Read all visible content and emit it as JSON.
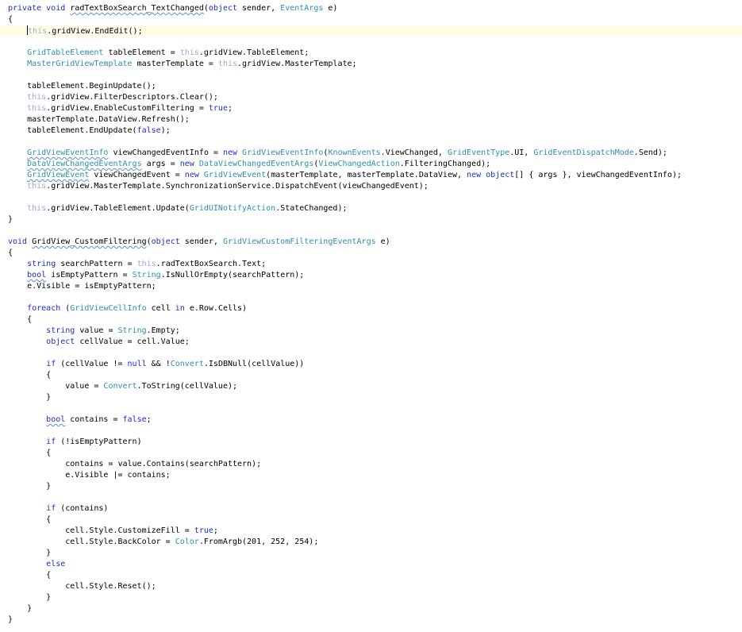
{
  "editor": {
    "caret_line": 2,
    "lines": [
      [
        [
          "private void ",
          "kw"
        ],
        [
          "radTextBoxSearch_TextChanged",
          "plain",
          "squiggle"
        ],
        [
          "(",
          "plain"
        ],
        [
          "object",
          "kw"
        ],
        [
          " sender, ",
          "plain"
        ],
        [
          "EventArgs",
          "type"
        ],
        [
          " e)",
          "plain"
        ]
      ],
      [
        [
          "{",
          "plain"
        ]
      ],
      [
        [
          "    ",
          "plain"
        ],
        [
          "this",
          "this"
        ],
        [
          ".gridView.EndEdit();",
          "plain"
        ]
      ],
      [],
      [
        [
          "    ",
          "plain"
        ],
        [
          "GridTableElement",
          "type"
        ],
        [
          " tableElement = ",
          "plain"
        ],
        [
          "this",
          "this"
        ],
        [
          ".gridView.TableElement;",
          "plain"
        ]
      ],
      [
        [
          "    ",
          "plain"
        ],
        [
          "MasterGridViewTemplate",
          "type"
        ],
        [
          " masterTemplate = ",
          "plain"
        ],
        [
          "this",
          "this"
        ],
        [
          ".gridView.MasterTemplate;",
          "plain"
        ]
      ],
      [],
      [
        [
          "    tableElement.BeginUpdate();",
          "plain"
        ]
      ],
      [
        [
          "    ",
          "plain"
        ],
        [
          "this",
          "this"
        ],
        [
          ".gridView.FilterDescriptors.Clear();",
          "plain"
        ]
      ],
      [
        [
          "    ",
          "plain"
        ],
        [
          "this",
          "this"
        ],
        [
          ".gridView.EnableCustomFiltering = ",
          "plain"
        ],
        [
          "true",
          "kw"
        ],
        [
          ";",
          "plain"
        ]
      ],
      [
        [
          "    masterTemplate.DataView.Refresh();",
          "plain"
        ]
      ],
      [
        [
          "    tableElement.EndUpdate(",
          "plain"
        ],
        [
          "false",
          "kw"
        ],
        [
          ");",
          "plain"
        ]
      ],
      [],
      [
        [
          "    ",
          "plain"
        ],
        [
          "GridViewEventInfo",
          "type",
          "squiggle"
        ],
        [
          " viewChangedEventInfo = ",
          "plain"
        ],
        [
          "new ",
          "kw"
        ],
        [
          "GridViewEventInfo",
          "type"
        ],
        [
          "(",
          "plain"
        ],
        [
          "KnownEvents",
          "type"
        ],
        [
          ".ViewChanged, ",
          "plain"
        ],
        [
          "GridEventType",
          "type"
        ],
        [
          ".UI, ",
          "plain"
        ],
        [
          "GridEventDispatchMode",
          "type"
        ],
        [
          ".Send);",
          "plain"
        ]
      ],
      [
        [
          "    ",
          "plain"
        ],
        [
          "DataViewChangedEventArgs",
          "type",
          "squiggle"
        ],
        [
          " args = ",
          "plain"
        ],
        [
          "new ",
          "kw"
        ],
        [
          "DataViewChangedEventArgs",
          "type"
        ],
        [
          "(",
          "plain"
        ],
        [
          "ViewChangedAction",
          "type"
        ],
        [
          ".FilteringChanged);",
          "plain"
        ]
      ],
      [
        [
          "    ",
          "plain"
        ],
        [
          "GridViewEvent",
          "type",
          "squiggle"
        ],
        [
          " viewChangedEvent = ",
          "plain"
        ],
        [
          "new ",
          "kw"
        ],
        [
          "GridViewEvent",
          "type"
        ],
        [
          "(masterTemplate, masterTemplate.DataView, ",
          "plain"
        ],
        [
          "new ",
          "kw"
        ],
        [
          "object",
          "kw"
        ],
        [
          "[] { args }, viewChangedEventInfo);",
          "plain"
        ]
      ],
      [
        [
          "    ",
          "plain"
        ],
        [
          "this",
          "this"
        ],
        [
          ".gridView.MasterTemplate.SynchronizationService.DispatchEvent(viewChangedEvent);",
          "plain"
        ]
      ],
      [],
      [
        [
          "    ",
          "plain"
        ],
        [
          "this",
          "this"
        ],
        [
          ".gridView.TableElement.Update(",
          "plain"
        ],
        [
          "GridUINotifyAction",
          "type"
        ],
        [
          ".StateChanged);",
          "plain"
        ]
      ],
      [
        [
          "}",
          "plain"
        ]
      ],
      [],
      [
        [
          "void ",
          "kw"
        ],
        [
          "GridView_CustomFiltering",
          "plain",
          "squiggle"
        ],
        [
          "(",
          "plain"
        ],
        [
          "object",
          "kw"
        ],
        [
          " sender, ",
          "plain"
        ],
        [
          "GridViewCustomFilteringEventArgs",
          "type"
        ],
        [
          " e)",
          "plain"
        ]
      ],
      [
        [
          "{",
          "plain"
        ]
      ],
      [
        [
          "    ",
          "plain"
        ],
        [
          "string",
          "kw"
        ],
        [
          " searchPattern = ",
          "plain"
        ],
        [
          "this",
          "this"
        ],
        [
          ".radTextBoxSearch.Text;",
          "plain"
        ]
      ],
      [
        [
          "    ",
          "plain"
        ],
        [
          "bool",
          "kw",
          "squiggle"
        ],
        [
          " isEmptyPattern = ",
          "plain"
        ],
        [
          "String",
          "type"
        ],
        [
          ".IsNullOrEmpty(searchPattern);",
          "plain"
        ]
      ],
      [
        [
          "    e.Visible = isEmptyPattern;",
          "plain"
        ]
      ],
      [],
      [
        [
          "    ",
          "plain"
        ],
        [
          "foreach",
          "kw"
        ],
        [
          " (",
          "plain"
        ],
        [
          "GridViewCellInfo",
          "type"
        ],
        [
          " cell ",
          "plain"
        ],
        [
          "in",
          "kw"
        ],
        [
          " e.Row.Cells)",
          "plain"
        ]
      ],
      [
        [
          "    {",
          "plain"
        ]
      ],
      [
        [
          "        ",
          "plain"
        ],
        [
          "string",
          "kw"
        ],
        [
          " value = ",
          "plain"
        ],
        [
          "String",
          "type"
        ],
        [
          ".Empty;",
          "plain"
        ]
      ],
      [
        [
          "        ",
          "plain"
        ],
        [
          "object",
          "kw"
        ],
        [
          " cellValue = cell.Value;",
          "plain"
        ]
      ],
      [],
      [
        [
          "        ",
          "plain"
        ],
        [
          "if",
          "kw"
        ],
        [
          " (cellValue != ",
          "plain"
        ],
        [
          "null",
          "kw"
        ],
        [
          " && !",
          "plain"
        ],
        [
          "Convert",
          "type"
        ],
        [
          ".IsDBNull(cellValue))",
          "plain"
        ]
      ],
      [
        [
          "        {",
          "plain"
        ]
      ],
      [
        [
          "            value = ",
          "plain"
        ],
        [
          "Convert",
          "type"
        ],
        [
          ".ToString(cellValue);",
          "plain"
        ]
      ],
      [
        [
          "        }",
          "plain"
        ]
      ],
      [],
      [
        [
          "        ",
          "plain"
        ],
        [
          "bool",
          "kw",
          "squiggle"
        ],
        [
          " contains = ",
          "plain"
        ],
        [
          "false",
          "kw"
        ],
        [
          ";",
          "plain"
        ]
      ],
      [],
      [
        [
          "        ",
          "plain"
        ],
        [
          "if",
          "kw"
        ],
        [
          " (!isEmptyPattern)",
          "plain"
        ]
      ],
      [
        [
          "        {",
          "plain"
        ]
      ],
      [
        [
          "            contains = value.Contains(searchPattern);",
          "plain"
        ]
      ],
      [
        [
          "            e.Visible |= contains;",
          "plain"
        ]
      ],
      [
        [
          "        }",
          "plain"
        ]
      ],
      [],
      [
        [
          "        ",
          "plain"
        ],
        [
          "if",
          "kw"
        ],
        [
          " (contains)",
          "plain"
        ]
      ],
      [
        [
          "        {",
          "plain"
        ]
      ],
      [
        [
          "            cell.Style.CustomizeFill = ",
          "plain"
        ],
        [
          "true",
          "kw"
        ],
        [
          ";",
          "plain"
        ]
      ],
      [
        [
          "            cell.Style.BackColor = ",
          "plain"
        ],
        [
          "Color",
          "type"
        ],
        [
          ".FromArgb(201, 252, 254);",
          "plain"
        ]
      ],
      [
        [
          "        }",
          "plain"
        ]
      ],
      [
        [
          "        ",
          "plain"
        ],
        [
          "else",
          "kw"
        ]
      ],
      [
        [
          "        {",
          "plain"
        ]
      ],
      [
        [
          "            cell.Style.Reset();",
          "plain"
        ]
      ],
      [
        [
          "        }",
          "plain"
        ]
      ],
      [
        [
          "    }",
          "plain"
        ]
      ],
      [
        [
          "}",
          "plain"
        ]
      ]
    ]
  },
  "colors": {
    "keyword": "#1b2bd6",
    "type": "#2b91af",
    "this_keyword": "#9da8d8",
    "plain": "#000000",
    "current_line": "#fffde8",
    "squiggle": "#5f8fd0"
  }
}
